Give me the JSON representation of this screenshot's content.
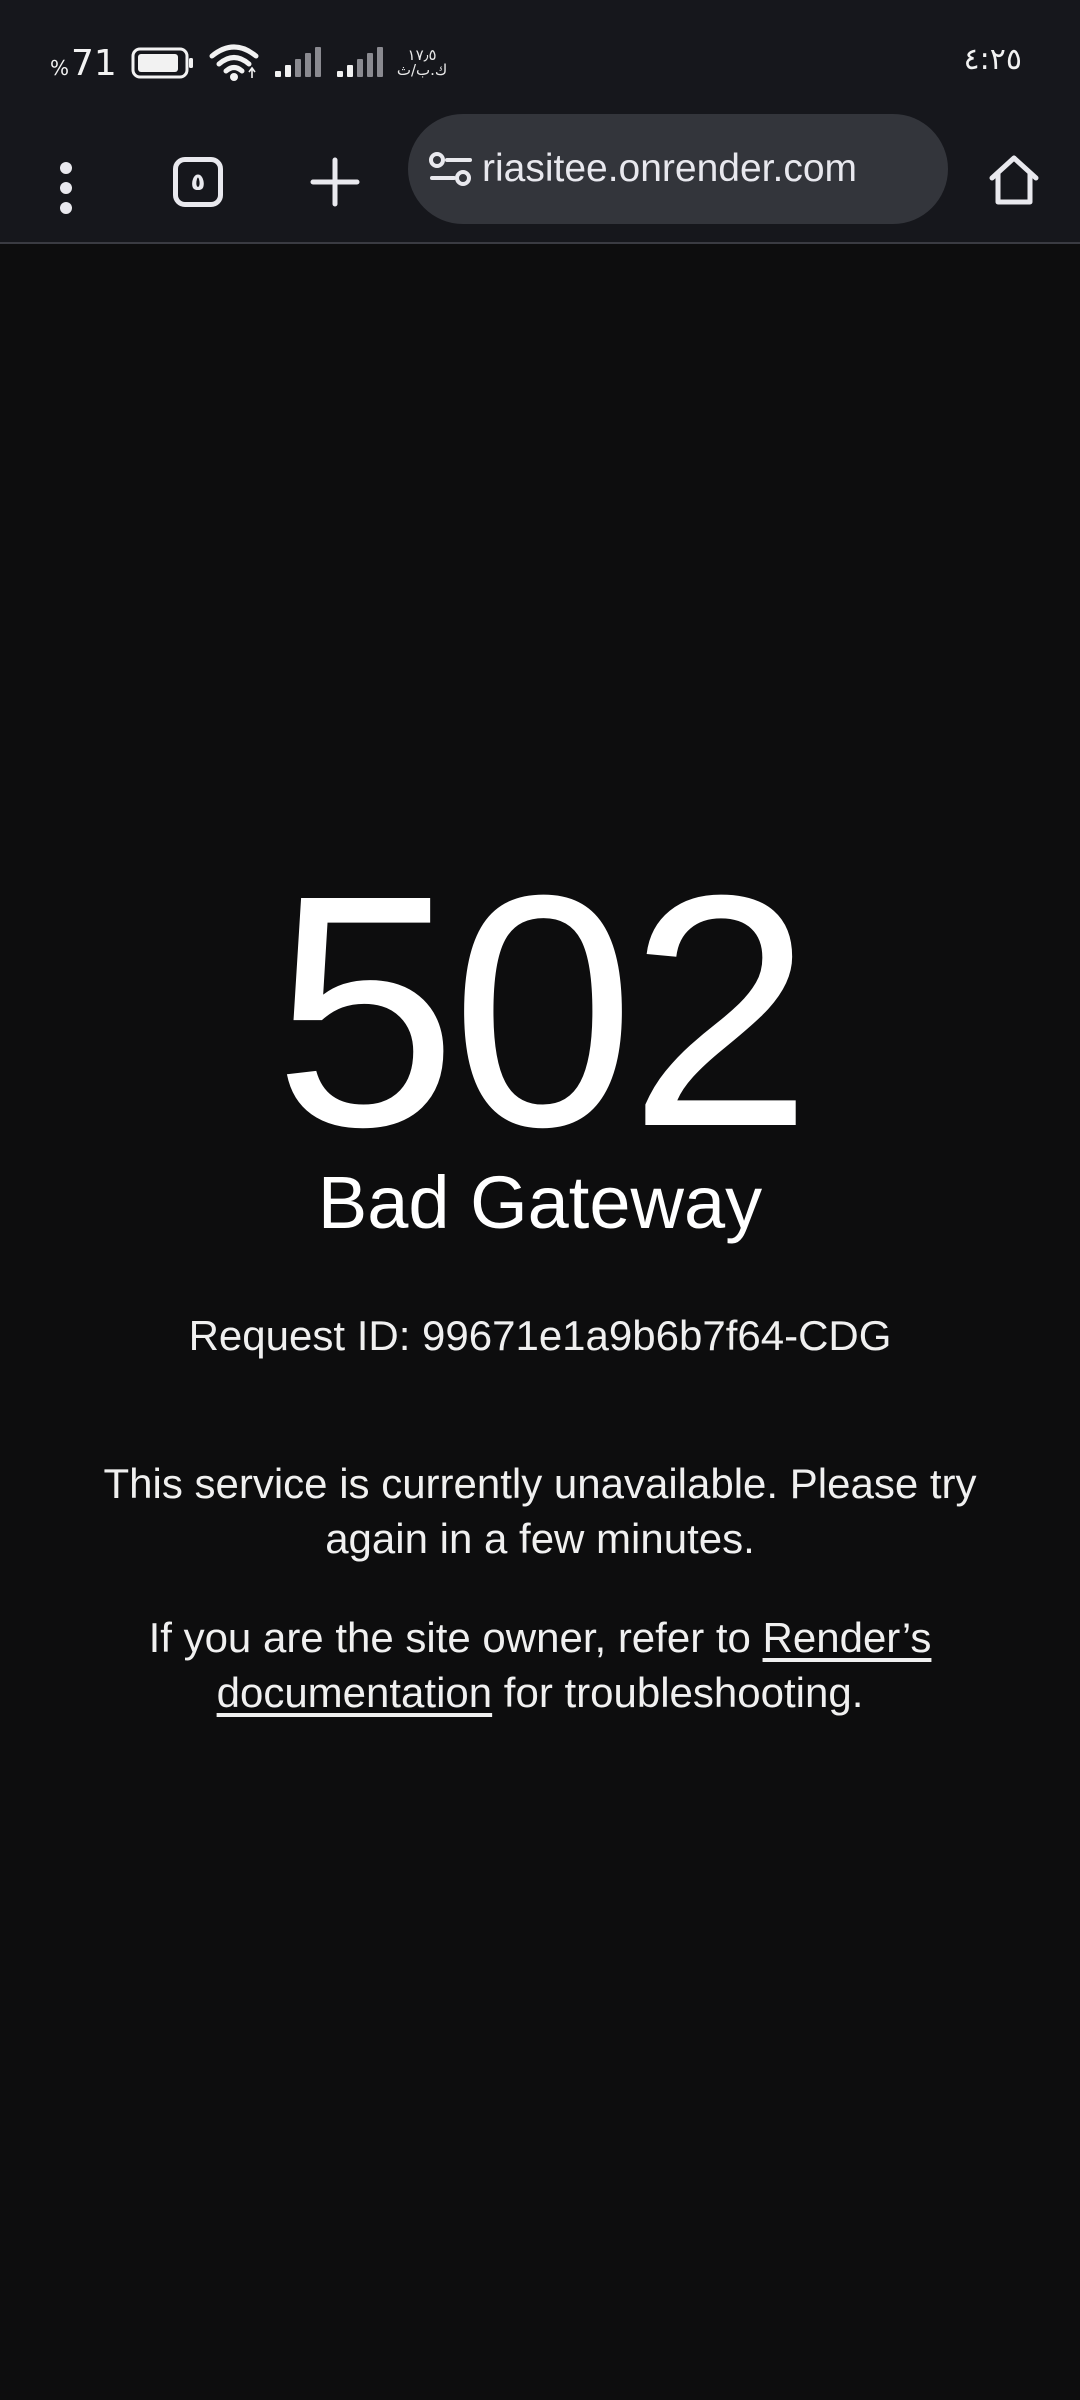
{
  "status_bar": {
    "battery_percent": "71",
    "percent_sign": "%",
    "net_speed_value": "١٧٫٥",
    "net_speed_unit": "ك.ب/ث",
    "time": "٤:٢٥",
    "icons": [
      "battery-icon",
      "wifi-icon",
      "signal-icon",
      "signal-icon"
    ]
  },
  "toolbar": {
    "tab_count": "٥",
    "url": "riasitee.onrender.com",
    "icons": [
      "more-vert-icon",
      "tabs-icon",
      "plus-icon",
      "tune-icon",
      "home-icon"
    ]
  },
  "error_page": {
    "code": "502",
    "status_text": "Bad Gateway",
    "request_id": "Request ID: 99671e1a9b6b7f64-CDG",
    "message": "This service is currently unavailable. Please try again in a few minutes.",
    "owner_note_prefix": "If you are the site owner, refer to ",
    "owner_note_link": "Render’s documentation",
    "owner_note_suffix": " for troubleshooting."
  },
  "colors": {
    "background": "#0d0d0e",
    "chrome": "#16171c",
    "url_bar": "#33353b",
    "text": "#ffffff"
  }
}
